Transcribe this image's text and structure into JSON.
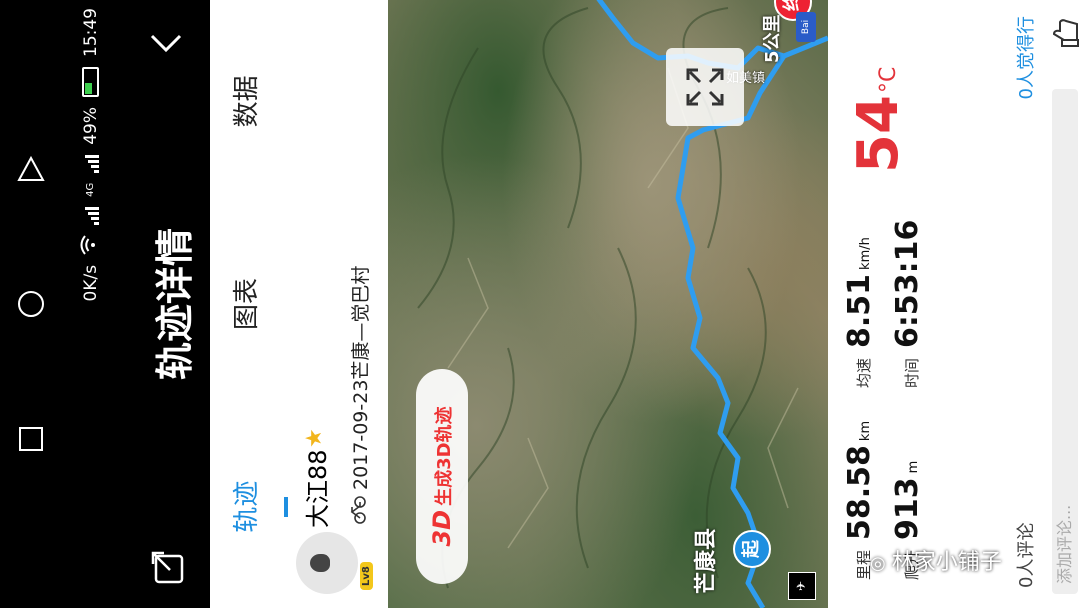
{
  "status": {
    "speed": "0K/s",
    "network": "4G",
    "battery": "49%",
    "time": "15:49"
  },
  "header": {
    "title": "轨迹详情"
  },
  "tabs": [
    {
      "label": "轨迹",
      "active": true
    },
    {
      "label": "图表",
      "active": false
    },
    {
      "label": "数据",
      "active": false
    }
  ],
  "user": {
    "name": "大江88",
    "level": "Lv8",
    "track_name": "2017-09-23芒康—觉巴村"
  },
  "map": {
    "btn_3d_prefix": "3D",
    "btn_3d_label": "生成3D轨迹",
    "start_marker": "起",
    "end_marker": "终",
    "start_place": "芒康县",
    "end_distance": "5公里",
    "road_label": "如美镇"
  },
  "stats": {
    "distance_label": "里程",
    "distance_value": "58.58",
    "distance_unit": "km",
    "climb_label": "爬升",
    "climb_value": "913",
    "climb_unit": "m",
    "speed_label": "均速",
    "speed_value": "8.51",
    "speed_unit": "km/h",
    "duration_label": "时间",
    "duration_value": "6:53:16",
    "temperature_value": "54",
    "temperature_unit": "°C"
  },
  "comments": {
    "count_text": "0人评论",
    "like_text": "0人觉得行",
    "input_placeholder": "添加评论..."
  },
  "watermark": "林家小铺子",
  "colors": {
    "accent": "#1e8fe0",
    "route": "#2f9df0",
    "temperature": "#e3333a",
    "end_marker": "#e23333"
  }
}
